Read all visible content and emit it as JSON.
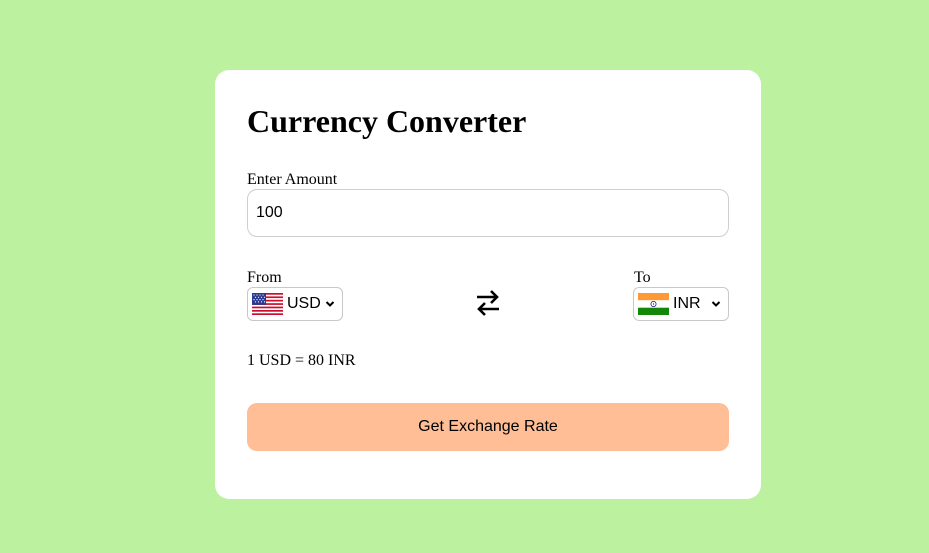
{
  "converter": {
    "title": "Currency Converter",
    "amount_label": "Enter Amount",
    "amount_value": "100",
    "from_label": "From",
    "to_label": "To",
    "from_currency": "USD",
    "to_currency": "INR",
    "from_flag_icon": "us-flag-icon",
    "to_flag_icon": "india-flag-icon",
    "swap_icon": "swap-arrows-icon",
    "rate_text": "1 USD = 80 INR",
    "button_label": "Get Exchange Rate"
  },
  "colors": {
    "page_background": "#bbf19f",
    "card_background": "#ffffff",
    "button_background": "#ffbe95"
  }
}
